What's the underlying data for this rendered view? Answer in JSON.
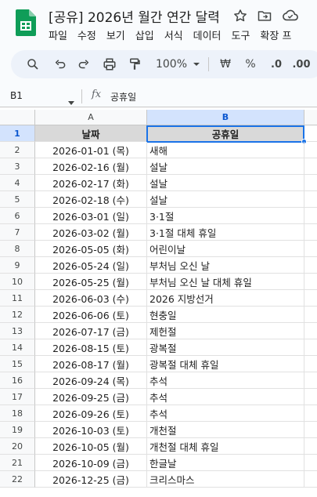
{
  "app": {
    "title": "[공유] 2026년 월간 연간 달력",
    "menu": [
      "파일",
      "수정",
      "보기",
      "삽입",
      "서식",
      "데이터",
      "도구",
      "확장 프"
    ]
  },
  "toolbar": {
    "zoom": "100%",
    "currency": "₩",
    "percent": "%",
    "decrease_decimal": ".0",
    "increase_decimal": ".00"
  },
  "formula_bar": {
    "cell_ref": "B1",
    "fx": "fx",
    "value": "공휴일"
  },
  "grid": {
    "columns": [
      "A",
      "B"
    ],
    "headers": [
      "날짜",
      "공휴일"
    ],
    "rows": [
      {
        "num": "2",
        "date": "2026-01-01 (목)",
        "holiday": "새해"
      },
      {
        "num": "3",
        "date": "2026-02-16 (월)",
        "holiday": "설날"
      },
      {
        "num": "4",
        "date": "2026-02-17 (화)",
        "holiday": "설날"
      },
      {
        "num": "5",
        "date": "2026-02-18 (수)",
        "holiday": "설날"
      },
      {
        "num": "6",
        "date": "2026-03-01 (일)",
        "holiday": "3·1절"
      },
      {
        "num": "7",
        "date": "2026-03-02 (월)",
        "holiday": "3·1절 대체 휴일"
      },
      {
        "num": "8",
        "date": "2026-05-05 (화)",
        "holiday": "어린이날"
      },
      {
        "num": "9",
        "date": "2026-05-24 (일)",
        "holiday": "부처님 오신 날"
      },
      {
        "num": "10",
        "date": "2026-05-25 (월)",
        "holiday": "부처님 오신 날 대체 휴일"
      },
      {
        "num": "11",
        "date": "2026-06-03 (수)",
        "holiday": "2026 지방선거"
      },
      {
        "num": "12",
        "date": "2026-06-06 (토)",
        "holiday": "현충일"
      },
      {
        "num": "13",
        "date": "2026-07-17 (금)",
        "holiday": "제헌절"
      },
      {
        "num": "14",
        "date": "2026-08-15 (토)",
        "holiday": "광복절"
      },
      {
        "num": "15",
        "date": "2026-08-17 (월)",
        "holiday": "광복절 대체 휴일"
      },
      {
        "num": "16",
        "date": "2026-09-24 (목)",
        "holiday": "추석"
      },
      {
        "num": "17",
        "date": "2026-09-25 (금)",
        "holiday": "추석"
      },
      {
        "num": "18",
        "date": "2026-09-26 (토)",
        "holiday": "추석"
      },
      {
        "num": "19",
        "date": "2026-10-03 (토)",
        "holiday": "개천절"
      },
      {
        "num": "20",
        "date": "2026-10-05 (월)",
        "holiday": "개천절 대체 휴일"
      },
      {
        "num": "21",
        "date": "2026-10-09 (금)",
        "holiday": "한글날"
      },
      {
        "num": "22",
        "date": "2026-12-25 (금)",
        "holiday": "크리스마스"
      }
    ],
    "header_row_num": "1"
  }
}
